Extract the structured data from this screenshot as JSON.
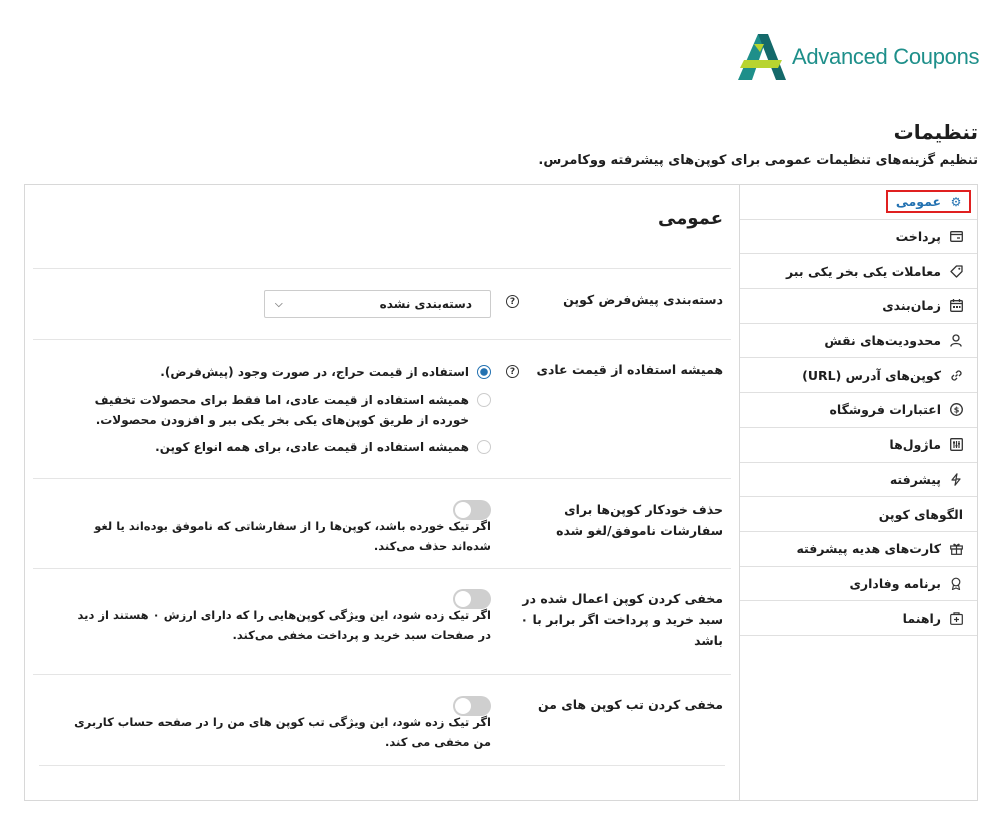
{
  "brand": {
    "name": "Advanced Coupons",
    "colors": {
      "teal": "#1e8f8a",
      "dark_teal": "#14696a",
      "lime": "#b8d430"
    }
  },
  "page": {
    "title": "تنظیمات",
    "subtitle": "تنظیم گزینه‌های تنظیمات عمومی برای کوپن‌های پیشرفته ووکامرس."
  },
  "sidebar": {
    "items": [
      {
        "label": "عمومی",
        "icon": "gear-icon",
        "active": true
      },
      {
        "label": "پرداخت",
        "icon": "credit-card-icon"
      },
      {
        "label": "معاملات یکی بخر یکی ببر",
        "icon": "tag-icon"
      },
      {
        "label": "زمان‌بندی",
        "icon": "calendar-icon"
      },
      {
        "label": "محدودیت‌های نقش",
        "icon": "user-icon"
      },
      {
        "label": "کوپن‌های آدرس (URL)",
        "icon": "link-icon"
      },
      {
        "label": "اعتبارات فروشگاه",
        "icon": "dollar-circle-icon"
      },
      {
        "label": "ماژول‌ها",
        "icon": "sliders-icon"
      },
      {
        "label": "پیشرفته",
        "icon": "lightning-icon"
      },
      {
        "label": "الگوهای کوپن",
        "icon": ""
      },
      {
        "label": "کارت‌های هدیه پیشرفته",
        "icon": "gift-icon"
      },
      {
        "label": "برنامه وفاداری",
        "icon": "award-icon"
      },
      {
        "label": "راهنما",
        "icon": "help-box-icon"
      }
    ]
  },
  "main": {
    "section_title": "عمومی",
    "default_category": {
      "label": "دسته‌بندی پیش‌فرض کوپن",
      "value": "دسته‌بندی نشده"
    },
    "regular_price": {
      "label": "همیشه استفاده از قیمت عادی",
      "options": [
        "استفاده از قیمت حراج، در صورت وجود (پیش‌فرض).",
        "همیشه استفاده از قیمت عادی، اما فقط برای محصولات تخفیف خورده از طریق کوپن‌های یکی بخر یکی ببر و افزودن محصولات.",
        "همیشه استفاده از قیمت عادی، برای همه انواع کوپن."
      ],
      "selected_index": 0
    },
    "auto_delete": {
      "label": "حذف خودکار کوپن‌ها برای سفارشات ناموفق/لغو شده",
      "description": "اگر تیک خورده باشد، کوپن‌ها را از سفارشاتی که ناموفق بوده‌اند یا لغو شده‌اند حذف می‌کند."
    },
    "hide_zero": {
      "label": "مخفی کردن کوپن اعمال شده در سبد خرید و پرداخت اگر برابر با ۰ باشد",
      "description": "اگر تیک زده شود، این ویژگی کوپن‌هایی را که دارای ارزش ۰ هستند از دید در صفحات سبد خرید و پرداخت مخفی می‌کند."
    },
    "hide_tab": {
      "label": "مخفی کردن تب کوپن های من",
      "description": "اگر تیک زده شود، این ویژگی تب کوپن های من را در صفحه حساب کاربری من مخفی می کند."
    }
  }
}
